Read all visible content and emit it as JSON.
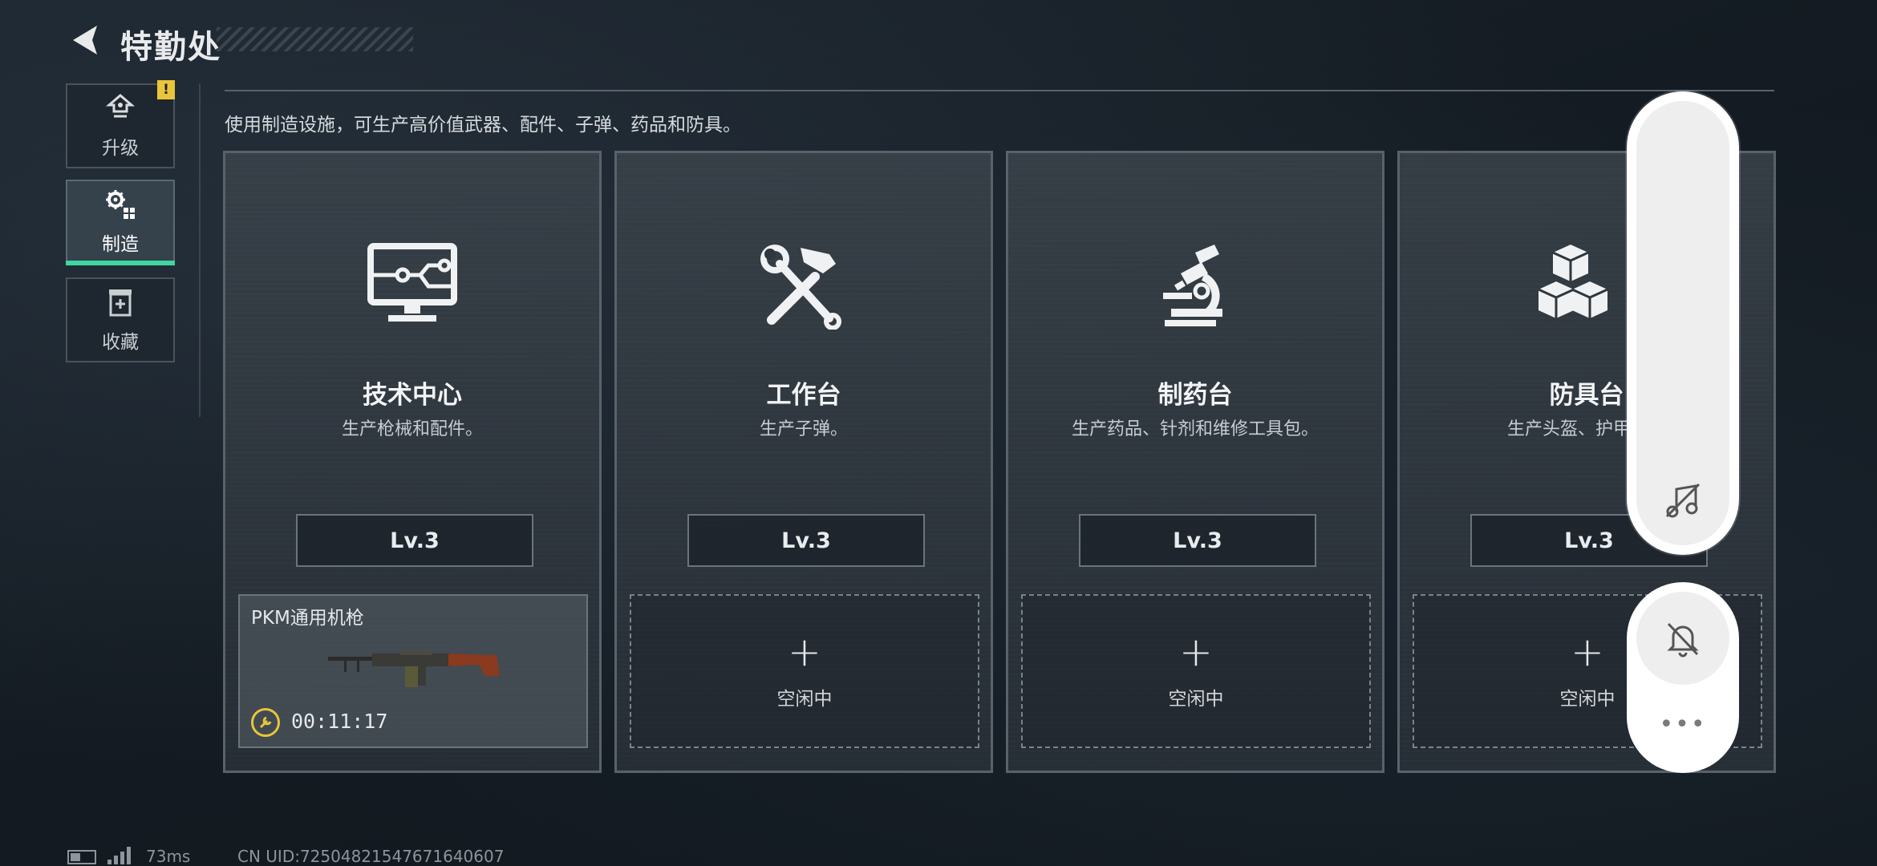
{
  "header": {
    "title": "特勤处"
  },
  "sidebar": {
    "items": [
      {
        "label": "升级",
        "icon": "upgrade-icon",
        "badge": "!"
      },
      {
        "label": "制造",
        "icon": "gear-cluster-icon",
        "active": true
      },
      {
        "label": "收藏",
        "icon": "collection-icon"
      }
    ]
  },
  "description": "使用制造设施，可生产高价值武器、配件、子弹、药品和防具。",
  "cards": [
    {
      "name": "技术中心",
      "desc": "生产枪械和配件。",
      "level": "Lv.3",
      "icon": "monitor-circuit-icon",
      "slot": {
        "busy": true,
        "item": "PKM通用机枪",
        "timer": "00:11:17"
      }
    },
    {
      "name": "工作台",
      "desc": "生产子弹。",
      "level": "Lv.3",
      "icon": "hammer-wrench-icon",
      "slot": {
        "busy": false,
        "plus": "+",
        "status": "空闲中"
      }
    },
    {
      "name": "制药台",
      "desc": "生产药品、针剂和维修工具包。",
      "level": "Lv.3",
      "icon": "microscope-icon",
      "slot": {
        "busy": false,
        "plus": "+",
        "status": "空闲中"
      }
    },
    {
      "name": "防具台",
      "desc": "生产头盔、护甲、胸",
      "level": "Lv.3",
      "icon": "cubes-icon",
      "slot": {
        "busy": false,
        "plus": "+",
        "status": "空闲中"
      }
    }
  ],
  "overlay": {
    "more": "•••"
  },
  "status_bar": {
    "ping": "73ms",
    "uid": "CN UID:72504821547671640607"
  },
  "colors": {
    "accent": "#3fd6a0",
    "badge": "#e9c53a",
    "card_border": "#59626b"
  }
}
